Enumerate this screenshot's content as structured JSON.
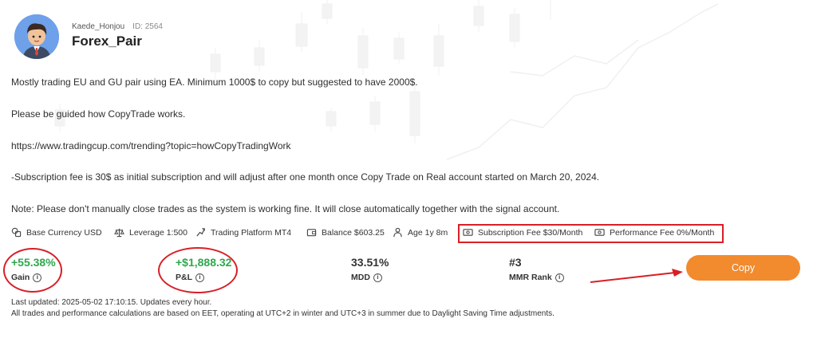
{
  "profile": {
    "username": "Kaede_Honjou",
    "user_id": "ID: 2564",
    "account_name": "Forex_Pair"
  },
  "description": [
    "Mostly trading EU and GU pair using EA. Minimum 1000$ to copy but suggested to have 2000$.",
    "Please be guided how CopyTrade works.",
    "https://www.tradingcup.com/trending?topic=howCopyTradingWork",
    "-Subscription fee is 30$ as initial subscription and will adjust after one month once Copy Trade on Real account started on March 20, 2024.",
    "Note: Please don't manually close trades as the system is working fine. It will close automatically together with the signal account."
  ],
  "info": {
    "base_currency": "Base Currency USD",
    "leverage": "Leverage 1:500",
    "platform": "Trading Platform MT4",
    "balance": "Balance $603.25",
    "age": "Age 1y 8m",
    "subscription_fee": "Subscription Fee $30/Month",
    "performance_fee": "Performance Fee 0%/Month"
  },
  "stats": [
    {
      "value": "+55.38%",
      "label": "Gain"
    },
    {
      "value": "+$1,888.32",
      "label": "P&L"
    },
    {
      "value": "33.51%",
      "label": "MDD"
    },
    {
      "value": "#3",
      "label": "MMR Rank"
    }
  ],
  "actions": {
    "copy_label": "Copy"
  },
  "footer": {
    "last_updated": "Last updated: 2025-05-02 17:10:15. Updates every hour.",
    "note": "All trades and performance calculations are based on EET, operating at UTC+2 in winter and UTC+3 in summer due to Daylight Saving Time adjustments."
  },
  "colors": {
    "accent": "#f28a2e",
    "gain_green": "#2ea84b",
    "annotation_red": "#d81f26",
    "avatar_bg": "#6fa0ea"
  },
  "icons": [
    "currency-icon",
    "leverage-icon",
    "platform-icon",
    "wallet-icon",
    "person-icon",
    "ticket-icon",
    "info-icon",
    "arrow-icon"
  ]
}
